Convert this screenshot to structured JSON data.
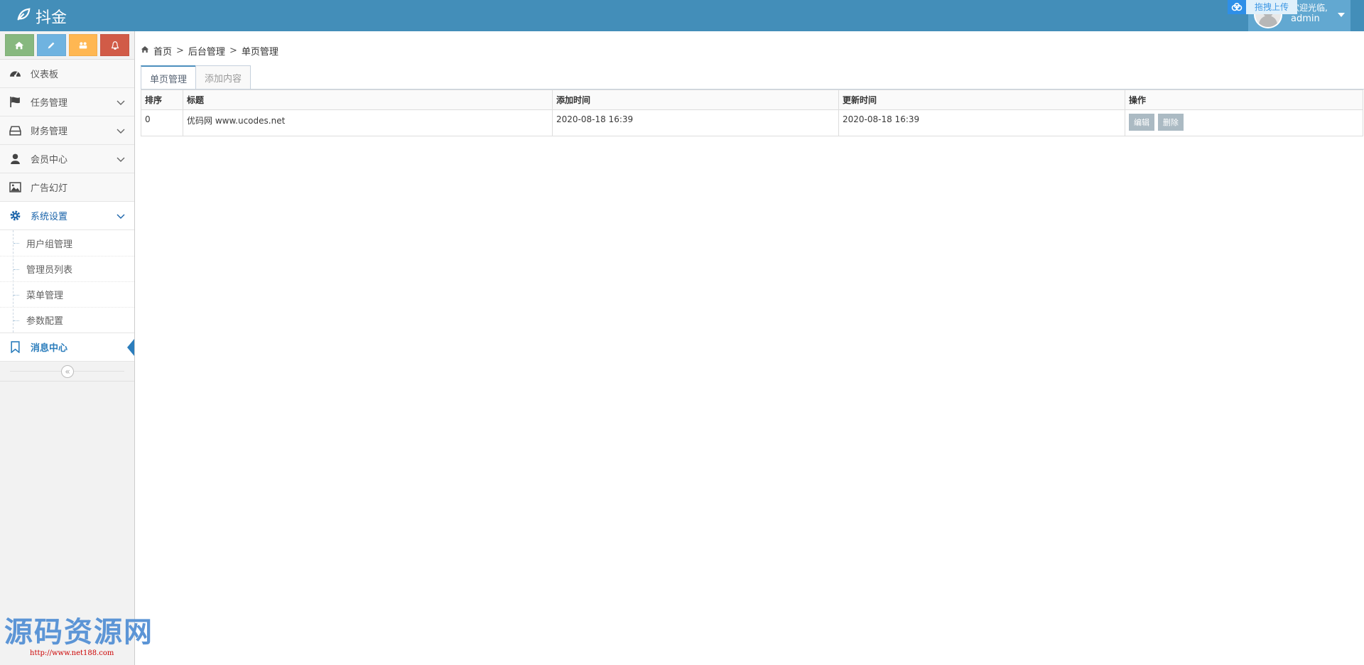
{
  "app": {
    "brand": "抖金"
  },
  "header": {
    "upload_label": "拖拽上传",
    "greeting": "欢迎光临,",
    "username": "admin"
  },
  "shortcuts": [
    {
      "icon": "home-icon",
      "color": "#87b87f"
    },
    {
      "icon": "pencil-icon",
      "color": "#6fb3e0"
    },
    {
      "icon": "users-icon",
      "color": "#ffb752"
    },
    {
      "icon": "bell-icon",
      "color": "#d15b47"
    }
  ],
  "sidebar": {
    "items": [
      {
        "label": "仪表板",
        "icon": "dashboard-icon"
      },
      {
        "label": "任务管理",
        "icon": "flag-icon"
      },
      {
        "label": "财务管理",
        "icon": "hdd-icon"
      },
      {
        "label": "会员中心",
        "icon": "user-icon"
      },
      {
        "label": "广告幻灯",
        "icon": "picture-icon"
      },
      {
        "label": "系统设置",
        "icon": "cog-icon"
      }
    ],
    "sub_items": [
      "用户组管理",
      "管理员列表",
      "菜单管理",
      "参数配置"
    ],
    "active_item": {
      "label": "消息中心",
      "icon": "bookmark-icon"
    }
  },
  "breadcrumb": {
    "home": "首页",
    "sep": ">",
    "level1": "后台管理",
    "level2": "单页管理"
  },
  "tabs": {
    "active": "单页管理",
    "inactive": "添加内容"
  },
  "table": {
    "headers": [
      "排序",
      "标题",
      "添加时间",
      "更新时间",
      "操作"
    ],
    "rows": [
      {
        "sort": "0",
        "title": "优码网 www.ucodes.net",
        "created": "2020-08-18 16:39",
        "updated": "2020-08-18 16:39",
        "edit": "编辑",
        "delete": "删除"
      }
    ]
  },
  "watermark": {
    "text": "源码资源网",
    "url": "http://www.net188.com"
  }
}
